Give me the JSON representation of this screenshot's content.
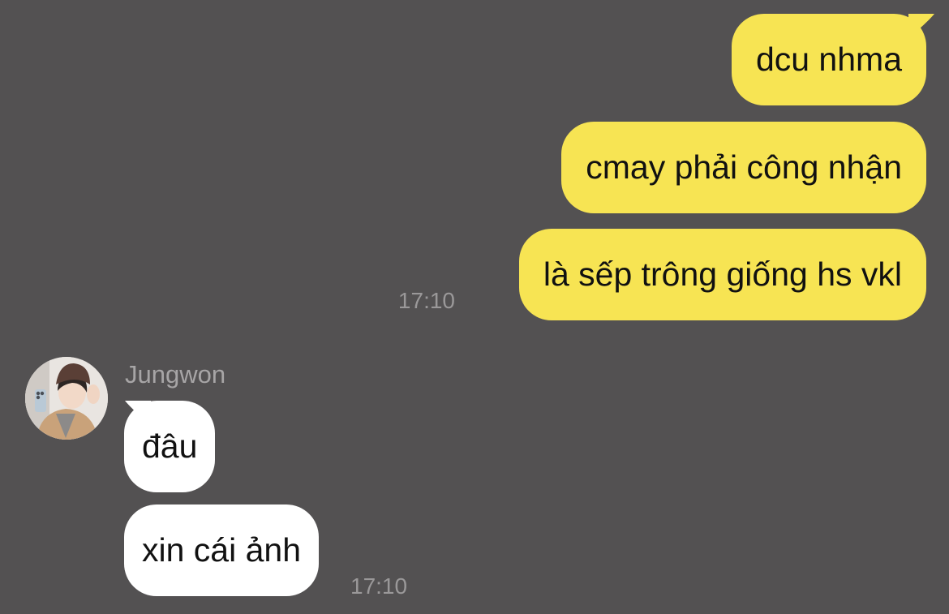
{
  "chat": {
    "outgoing": [
      {
        "text": "dcu nhma"
      },
      {
        "text": "cmay phải công nhận"
      },
      {
        "text": "là sếp trông giống hs vkl"
      }
    ],
    "outgoing_time": "17:10",
    "incoming_sender": "Jungwon",
    "incoming": [
      {
        "text": "đâu"
      },
      {
        "text": "xin cái ảnh"
      }
    ],
    "incoming_time": "17:10"
  },
  "colors": {
    "background": "#535152",
    "outgoing_bubble": "#f7e453",
    "incoming_bubble": "#ffffff",
    "timestamp": "#9a9899",
    "sender_name": "#a7a5a6"
  },
  "icons": {
    "avatar": "profile-photo"
  }
}
